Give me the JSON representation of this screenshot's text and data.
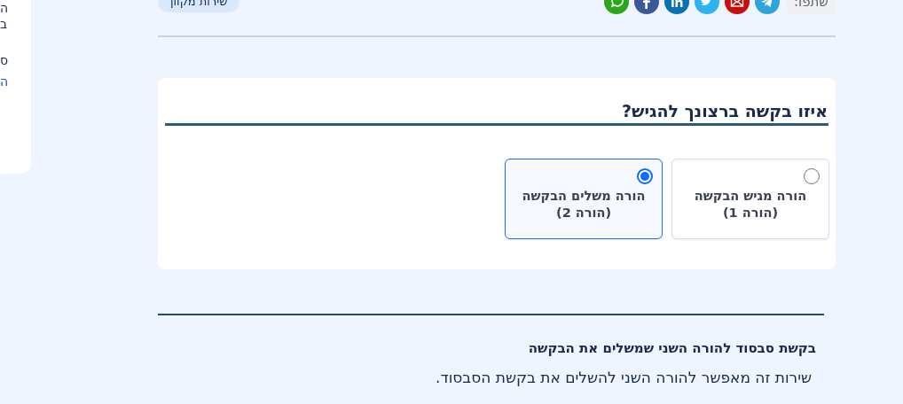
{
  "sidebar": {
    "lines": [
      {
        "text": "ה",
        "kind": "text"
      },
      {
        "text": "ב",
        "kind": "text"
      },
      {
        "text": "ס",
        "kind": "text"
      },
      {
        "text": "ה",
        "kind": "link"
      }
    ]
  },
  "share": {
    "label": "שתפו:"
  },
  "badge": "שירות מקוון",
  "question": {
    "title": "איזו בקשה ברצונך להגיש?",
    "options": [
      {
        "label": "הורה מגיש הבקשה",
        "note": "(הורה 1)",
        "selected": false
      },
      {
        "label": "הורה משלים הבקשה",
        "note": "(הורה 2)",
        "selected": true
      }
    ]
  },
  "service": {
    "title": "בקשת סבסוד להורה השני שמשלים את הבקשה",
    "description": "שירות זה מאפשר להורה השני להשלים את בקשת הסבסוד."
  }
}
